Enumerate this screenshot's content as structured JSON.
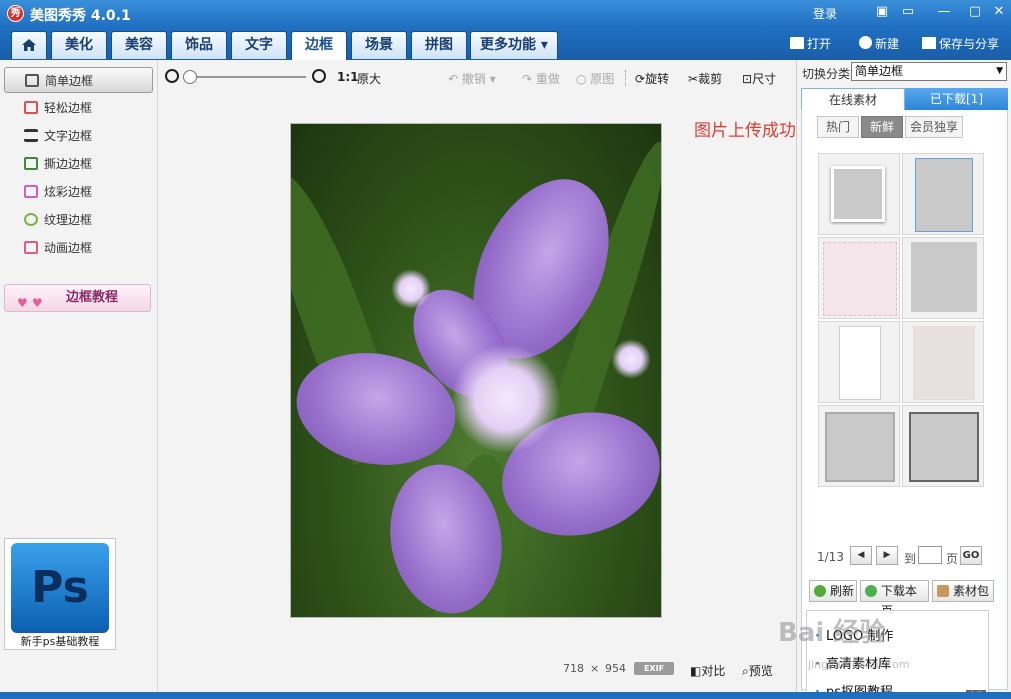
{
  "app": {
    "title": "美图秀秀 4.0.1",
    "logo_text": "秀",
    "login": "登录"
  },
  "window_controls": {
    "skin": "▭",
    "min": "—",
    "restore": "▢",
    "close": "✕",
    "menu": "▣"
  },
  "nav": {
    "tabs": [
      "美化",
      "美容",
      "饰品",
      "文字",
      "边框",
      "场景",
      "拼图",
      "更多功能 ▾"
    ],
    "active": "边框",
    "actions": {
      "open": "打开",
      "new": "新建",
      "save_share": "保存与分享"
    }
  },
  "sidebar": {
    "items": [
      {
        "label": "简单边框",
        "color": "#555555"
      },
      {
        "label": "轻松边框",
        "color": "#d9534f"
      },
      {
        "label": "文字边框",
        "color": "#333333"
      },
      {
        "label": "撕边边框",
        "color": "#3c8c3c"
      },
      {
        "label": "炫彩边框",
        "color": "#d35fb7"
      },
      {
        "label": "纹理边框",
        "color": "#7cb342"
      },
      {
        "label": "动画边框",
        "color": "#e05a8a"
      }
    ],
    "active_index": 0,
    "tutorial": "边框教程",
    "ps_ad": {
      "tile": "Ps",
      "caption": "新手ps基础教程"
    }
  },
  "toolbar": {
    "ratio": "1:1",
    "original_size": "原大",
    "undo": "撤销",
    "redo": "重做",
    "original": "原图",
    "rotate": "旋转",
    "crop": "裁剪",
    "size": "尺寸"
  },
  "canvas": {
    "width_px": "718",
    "times": "×",
    "height_px": "954",
    "exif": "EXIF",
    "compare": "对比",
    "preview": "预览"
  },
  "upload_message": "图片上传成功",
  "right_panel": {
    "switch_label": "切换分类",
    "switch_value": "简单边框",
    "tabs": {
      "online": "在线素材",
      "downloaded": "已下载[1]"
    },
    "subtabs": [
      "热门",
      "新鲜",
      "会员独享"
    ],
    "active_subtab": "新鲜",
    "pager": {
      "current": "1/13",
      "goto": "到",
      "page": "页",
      "go": "GO",
      "prev": "◀",
      "next": "▶"
    },
    "actions": {
      "refresh": "刷新",
      "download_page": "下载本页",
      "material_pack": "素材包"
    },
    "ads": [
      "LOGO 制作",
      "高清素材库",
      "ps抠图教程"
    ],
    "ad_tag": "广告"
  },
  "watermark": {
    "text": "Bai 经验",
    "url": "jingyan.baidu.com"
  },
  "colors": {
    "title_bar": "#1f6fc1",
    "accent": "#2e86d9",
    "alert": "#e23c32"
  }
}
